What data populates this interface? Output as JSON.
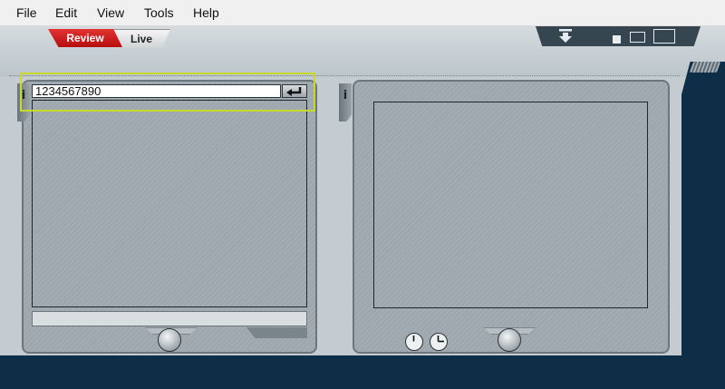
{
  "menu": {
    "file": "File",
    "edit": "Edit",
    "view": "View",
    "tools": "Tools",
    "help": "Help"
  },
  "tabs": {
    "review": "Review",
    "live": "Live",
    "active": "Review"
  },
  "left_panel": {
    "info_label": "i",
    "search": {
      "value": "1234567890",
      "placeholder": ""
    },
    "enter_icon": "enter-arrow-icon"
  },
  "right_panel": {
    "info_label": "i"
  },
  "toolbar": {
    "download_icon": "download-arrow-icon",
    "layout_icons": [
      "layout-small-icon",
      "layout-medium-icon",
      "layout-large-icon"
    ]
  },
  "colors": {
    "accent_red": "#d01f1f",
    "highlight": "#c8db2d",
    "navy": "#0e2d47",
    "panel_gray": "#9ea7ad"
  }
}
